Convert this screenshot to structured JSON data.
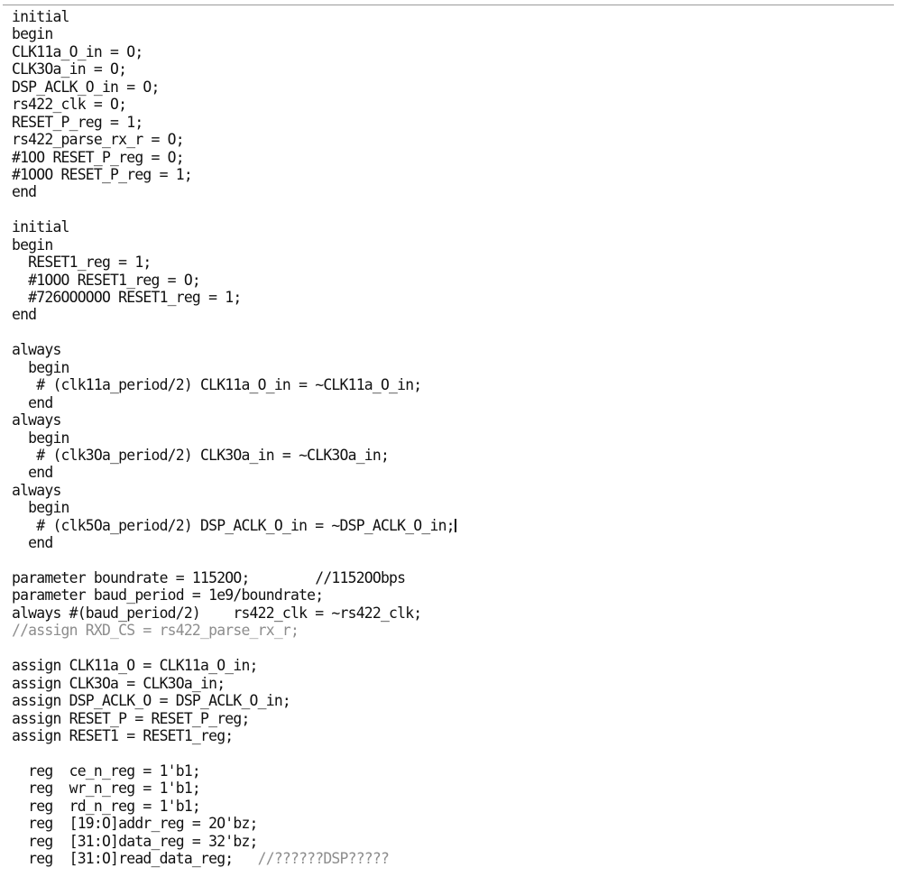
{
  "document": {
    "kind": "verilog-source-code",
    "language": "Verilog",
    "rule_color": "#9a9a9a",
    "text_color": "#101010",
    "comment_color": "#8d8d8d",
    "background_color": "#ffffff",
    "caret_visible": true,
    "caret_line_index": 31,
    "lines": [
      {
        "text": "initial",
        "style": "normal"
      },
      {
        "text": "begin",
        "style": "normal"
      },
      {
        "text": "CLK11a_O_in = O;",
        "style": "normal"
      },
      {
        "text": "CLK3Oa_in = O;",
        "style": "normal"
      },
      {
        "text": "DSP_ACLK_O_in = O;",
        "style": "normal"
      },
      {
        "text": "rs422_clk = O;",
        "style": "normal"
      },
      {
        "text": "RESET_P_reg = 1;",
        "style": "normal"
      },
      {
        "text": "rs422_parse_rx_r = O;",
        "style": "normal"
      },
      {
        "text": "#1OO RESET_P_reg = O;",
        "style": "normal"
      },
      {
        "text": "#1OOO RESET_P_reg = 1;",
        "style": "normal"
      },
      {
        "text": "end",
        "style": "normal"
      },
      {
        "text": "",
        "style": "blank"
      },
      {
        "text": "initial",
        "style": "normal"
      },
      {
        "text": "begin",
        "style": "normal"
      },
      {
        "text": "  RESET1_reg = 1;",
        "style": "normal"
      },
      {
        "text": "  #1OOO RESET1_reg = O;",
        "style": "normal"
      },
      {
        "text": "  #726OOOOOO RESET1_reg = 1;",
        "style": "normal"
      },
      {
        "text": "end",
        "style": "normal"
      },
      {
        "text": "",
        "style": "blank"
      },
      {
        "text": "always",
        "style": "normal"
      },
      {
        "text": "  begin",
        "style": "normal"
      },
      {
        "text": "   # (clk11a_period/2) CLK11a_O_in = ~CLK11a_O_in;",
        "style": "normal"
      },
      {
        "text": "  end",
        "style": "normal"
      },
      {
        "text": "always",
        "style": "normal"
      },
      {
        "text": "  begin",
        "style": "normal"
      },
      {
        "text": "   # (clk3Oa_period/2) CLK3Oa_in = ~CLK3Oa_in;",
        "style": "normal"
      },
      {
        "text": "  end",
        "style": "normal"
      },
      {
        "text": "always",
        "style": "normal"
      },
      {
        "text": "  begin",
        "style": "normal"
      },
      {
        "text": "   # (clk5Oa_period/2) DSP_ACLK_O_in = ~DSP_ACLK_O_in;",
        "style": "caret"
      },
      {
        "text": "  end",
        "style": "normal"
      },
      {
        "text": "",
        "style": "blank"
      },
      {
        "text": "parameter boundrate = 1152OO;        //1152OObps",
        "style": "normal"
      },
      {
        "text": "parameter baud_period = 1e9/boundrate;",
        "style": "normal"
      },
      {
        "text": "always #(baud_period/2)    rs422_clk = ~rs422_clk;",
        "style": "normal"
      },
      {
        "text": "//assign RXD_CS = rs422_parse_rx_r;",
        "style": "dim"
      },
      {
        "text": "",
        "style": "blank"
      },
      {
        "text": "assign CLK11a_O = CLK11a_O_in;",
        "style": "normal"
      },
      {
        "text": "assign CLK3Oa = CLK3Oa_in;",
        "style": "normal"
      },
      {
        "text": "assign DSP_ACLK_O = DSP_ACLK_O_in;",
        "style": "normal"
      },
      {
        "text": "assign RESET_P = RESET_P_reg;",
        "style": "normal"
      },
      {
        "text": "assign RESET1 = RESET1_reg;",
        "style": "normal"
      },
      {
        "text": "",
        "style": "blank"
      },
      {
        "text": "  reg  ce_n_reg = 1'b1;",
        "style": "normal"
      },
      {
        "text": "  reg  wr_n_reg = 1'b1;",
        "style": "normal"
      },
      {
        "text": "  reg  rd_n_reg = 1'b1;",
        "style": "normal"
      },
      {
        "text": "  reg  [19:O]addr_reg = 2O'bz;",
        "style": "normal"
      },
      {
        "text": "  reg  [31:O]data_reg = 32'bz;",
        "style": "normal"
      },
      {
        "text": "  reg  [31:O]read_data_reg;   //??????DSP?????",
        "style": "mixed-comment"
      }
    ],
    "mixed_comment": {
      "code_part": "  reg  [31:O]read_data_reg;   ",
      "comment_part": "//??????DSP?????"
    }
  }
}
